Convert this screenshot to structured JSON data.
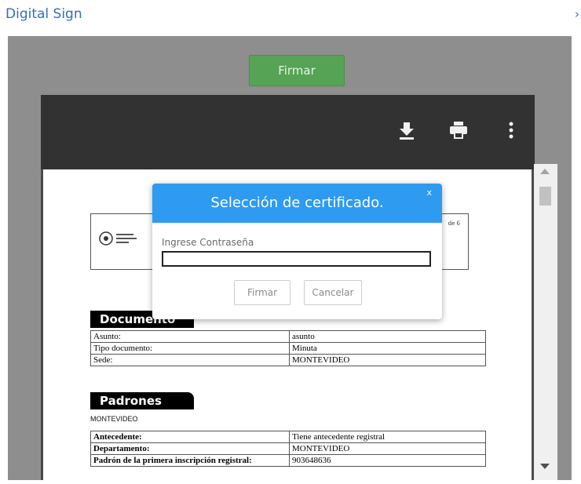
{
  "header": {
    "title": "Digital Sign",
    "chevron": "›"
  },
  "viewer": {
    "sign_button": "Firmar",
    "toolbar": {
      "icons": [
        "download-icon",
        "print-icon",
        "more-vert-icon"
      ]
    },
    "page": {
      "page_indicator": "de 6",
      "sections": [
        {
          "label": "Documento",
          "rows": [
            [
              "Asunto:",
              "asunto"
            ],
            [
              "Tipo documento:",
              "Minuta"
            ],
            [
              "Sede:",
              "MONTEVIDEO"
            ]
          ]
        },
        {
          "label": "Padrones",
          "subtitle": "MONTEVIDEO",
          "rows": [
            [
              "Antecedente:",
              "Tiene antecedente registral"
            ],
            [
              "Departamento:",
              "MONTEVIDEO"
            ],
            [
              "Padrón de la primera inscripción registral:",
              "903648636"
            ]
          ]
        }
      ]
    }
  },
  "modal": {
    "title": "Selección de certificado.",
    "close": "x",
    "password_label": "Ingrese Contraseña",
    "password_value": "",
    "sign_button": "Firmar",
    "cancel_button": "Cancelar"
  },
  "colors": {
    "link": "#2f6fc1",
    "sign_green": "#56a356",
    "modal_header": "#2e9bf0"
  }
}
